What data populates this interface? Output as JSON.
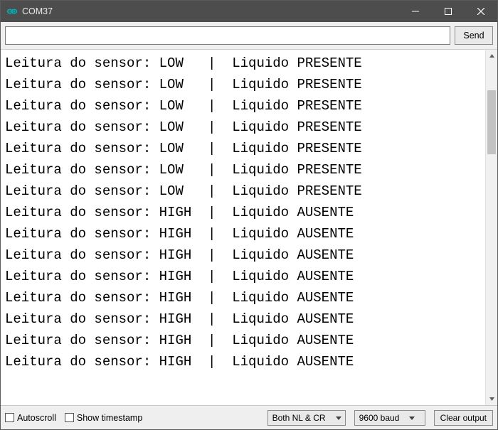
{
  "window": {
    "title": "COM37"
  },
  "send": {
    "input_value": "",
    "input_placeholder": "",
    "button_label": "Send"
  },
  "output": {
    "lines": [
      "Leitura do sensor: LOW   |  Liquido PRESENTE",
      "Leitura do sensor: LOW   |  Liquido PRESENTE",
      "Leitura do sensor: LOW   |  Liquido PRESENTE",
      "Leitura do sensor: LOW   |  Liquido PRESENTE",
      "Leitura do sensor: LOW   |  Liquido PRESENTE",
      "Leitura do sensor: LOW   |  Liquido PRESENTE",
      "Leitura do sensor: LOW   |  Liquido PRESENTE",
      "Leitura do sensor: HIGH  |  Liquido AUSENTE",
      "Leitura do sensor: HIGH  |  Liquido AUSENTE",
      "Leitura do sensor: HIGH  |  Liquido AUSENTE",
      "Leitura do sensor: HIGH  |  Liquido AUSENTE",
      "Leitura do sensor: HIGH  |  Liquido AUSENTE",
      "Leitura do sensor: HIGH  |  Liquido AUSENTE",
      "Leitura do sensor: HIGH  |  Liquido AUSENTE",
      "Leitura do sensor: HIGH  |  Liquido AUSENTE"
    ]
  },
  "bottom": {
    "autoscroll_label": "Autoscroll",
    "autoscroll_checked": false,
    "show_timestamp_label": "Show timestamp",
    "show_timestamp_checked": false,
    "line_ending_selected": "Both NL & CR",
    "baud_selected": "9600 baud",
    "clear_label": "Clear output"
  },
  "colors": {
    "titlebar_bg": "#4d4d4d",
    "arduino_teal": "#00979D"
  }
}
